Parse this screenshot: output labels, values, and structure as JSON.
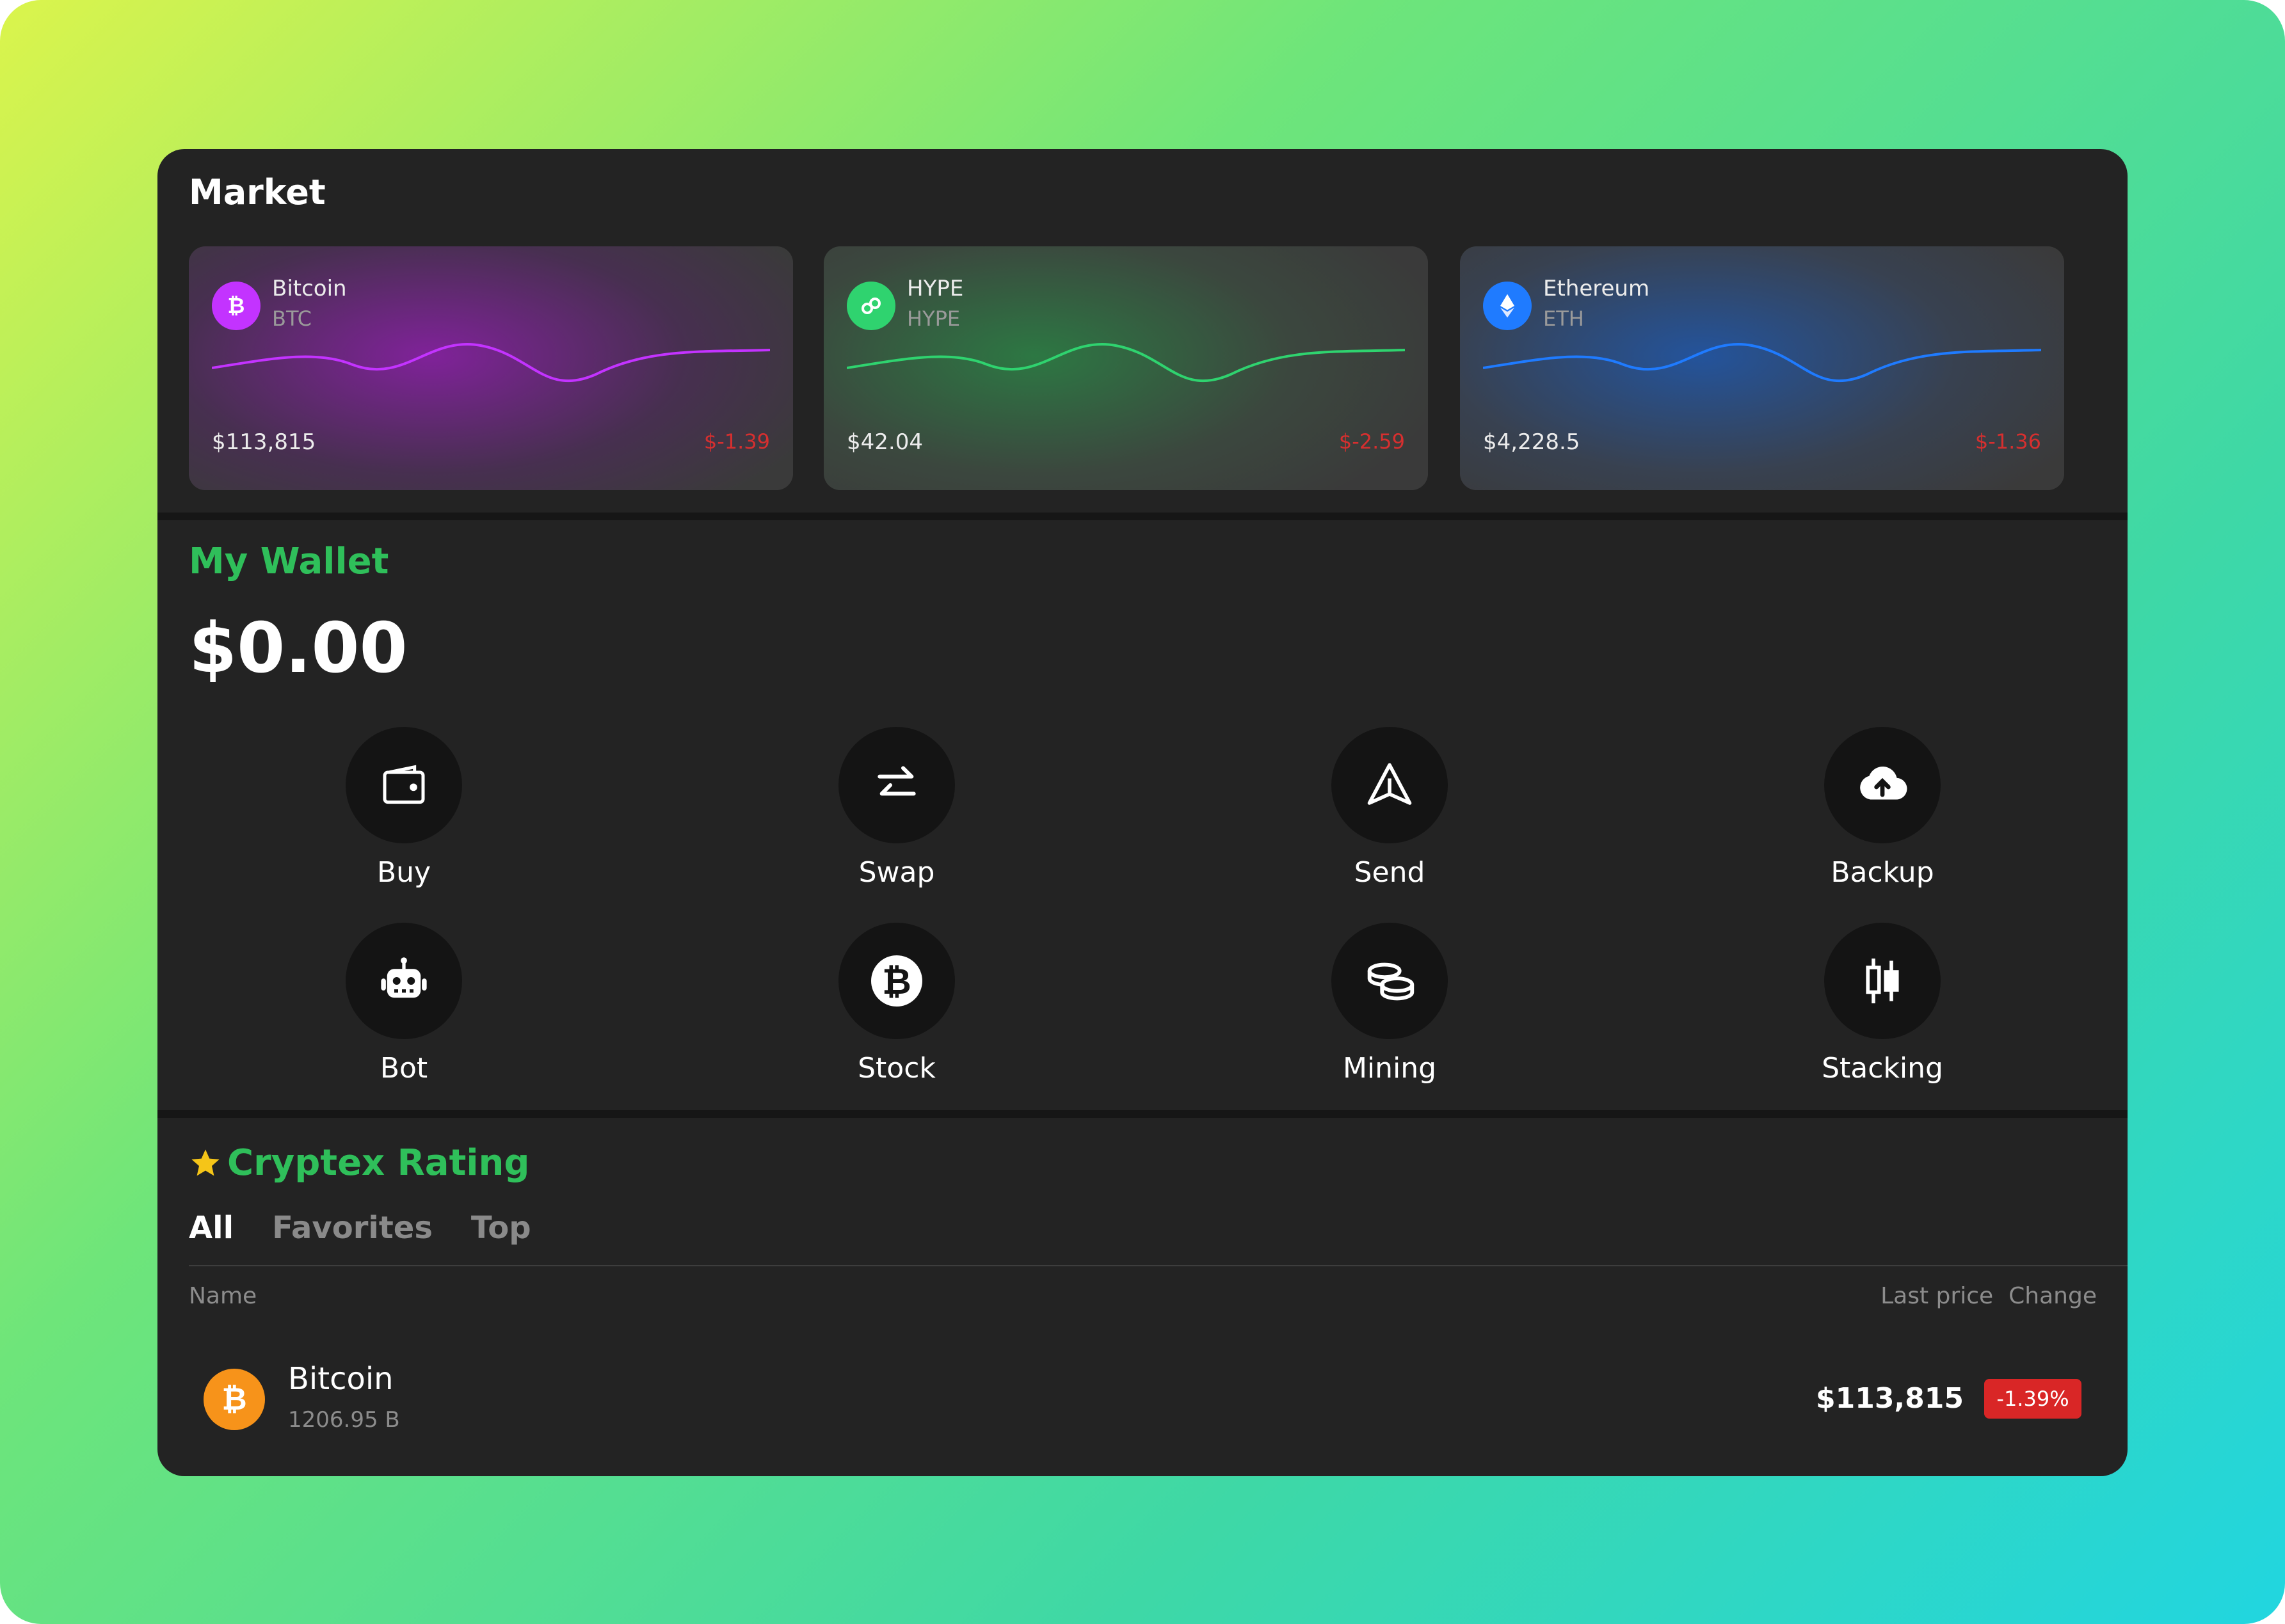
{
  "market": {
    "title": "Market",
    "cards": [
      {
        "name": "Bitcoin",
        "symbol": "BTC",
        "price": "$113,815",
        "change": "$-1.39",
        "icon": "bitcoin-icon",
        "color": "#c333ff"
      },
      {
        "name": "HYPE",
        "symbol": "HYPE",
        "price": "$42.04",
        "change": "$-2.59",
        "icon": "hype-icon",
        "color": "#2fd36f"
      },
      {
        "name": "Ethereum",
        "symbol": "ETH",
        "price": "$4,228.5",
        "change": "$-1.36",
        "icon": "ethereum-icon",
        "color": "#1f7bff"
      }
    ]
  },
  "wallet": {
    "title": "My Wallet",
    "balance": "$0.00",
    "actions": [
      {
        "label": "Buy",
        "icon": "wallet-icon"
      },
      {
        "label": "Swap",
        "icon": "swap-arrows-icon"
      },
      {
        "label": "Send",
        "icon": "send-icon"
      },
      {
        "label": "Backup",
        "icon": "cloud-upload-icon"
      },
      {
        "label": "Bot",
        "icon": "robot-icon"
      },
      {
        "label": "Stock",
        "icon": "bitcoin-icon"
      },
      {
        "label": "Mining",
        "icon": "coins-icon"
      },
      {
        "label": "Stacking",
        "icon": "candlestick-icon"
      }
    ]
  },
  "rating": {
    "title": "Cryptex Rating",
    "icon": "star-icon",
    "tabs": [
      "All",
      "Favorites",
      "Top"
    ],
    "columns": {
      "name": "Name",
      "last_price": "Last price",
      "change": "Change"
    },
    "rows": [
      {
        "name": "Bitcoin",
        "amount": "1206.95 B",
        "price": "$113,815",
        "change": "-1.39%",
        "icon": "bitcoin-icon"
      }
    ]
  },
  "colors": {
    "accent": "#2fbf5a",
    "negative": "#d92626",
    "panel": "#232323"
  }
}
